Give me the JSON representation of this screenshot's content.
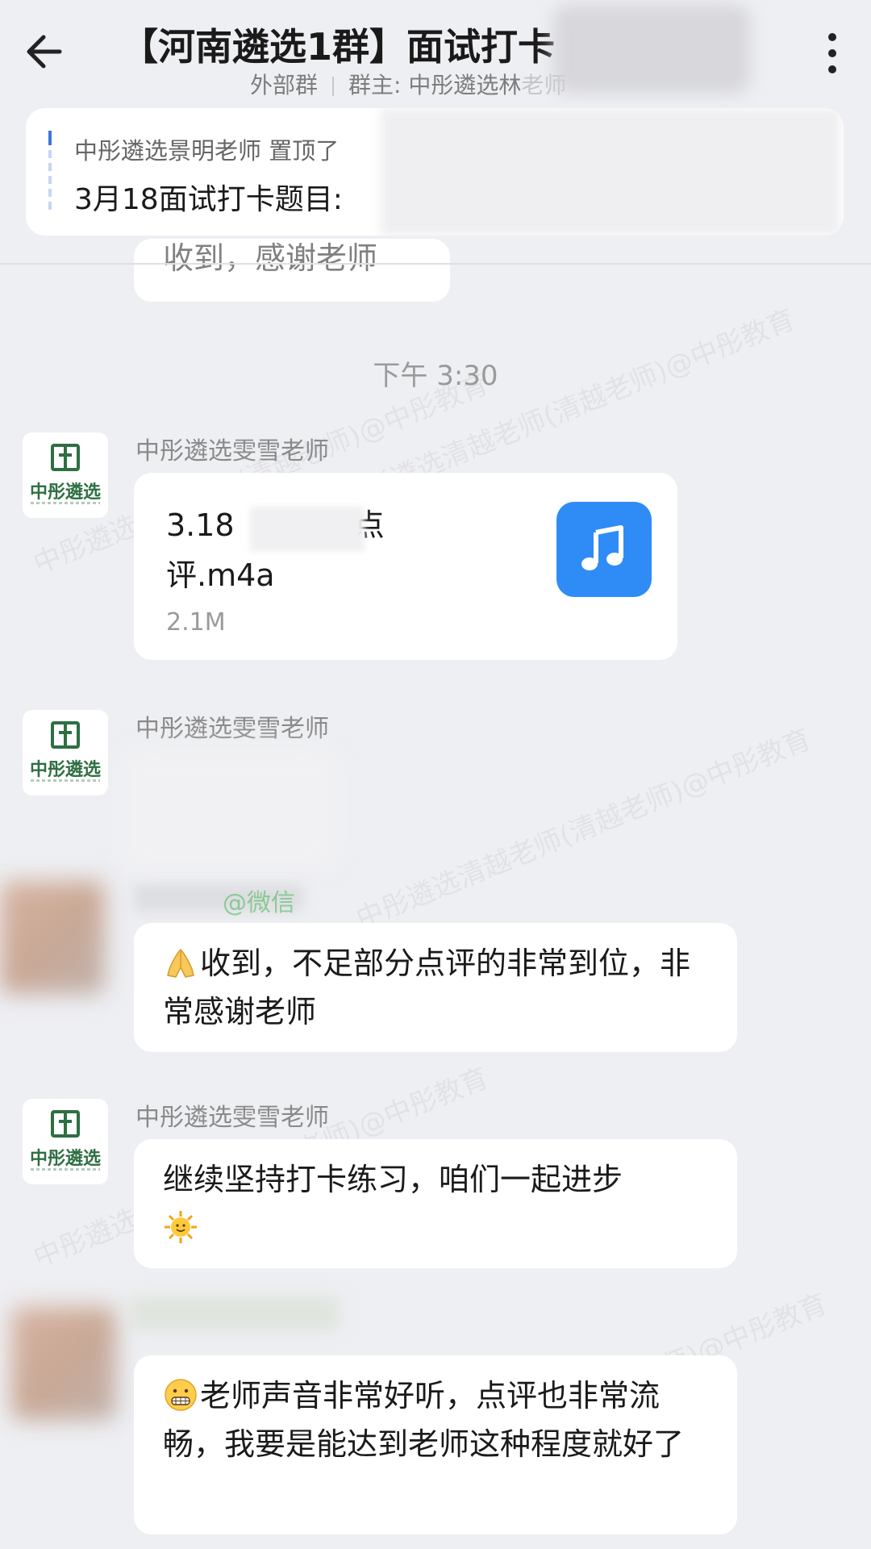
{
  "header": {
    "title": "【河南遴选1群】面试打卡",
    "external": "外部群",
    "owner": "群主: 中彤遴选林",
    "owner_suffix": "老师"
  },
  "pinned": {
    "line1": "中彤遴选景明老师 置顶了",
    "line2": "3月18面试打卡题目:"
  },
  "prev_message_tail": "收到，感谢老师",
  "timestamp": "下午 3:30",
  "messages": [
    {
      "sender": "中彤遴选雯雪老师",
      "avatar_text": "中彤遴选",
      "file": {
        "name_part1": "3.18",
        "name_part2": "点",
        "name_part3": "评.m4a",
        "size": "2.1M",
        "icon": "music-note-icon"
      }
    },
    {
      "sender": "中彤遴选雯雪老师",
      "avatar_text": "中彤遴选"
    },
    {
      "sender_suffix": "@微信",
      "text": "收到，不足部分点评的非常到位，非常感谢老师",
      "emoji": "folded-hands-icon"
    },
    {
      "sender": "中彤遴选雯雪老师",
      "avatar_text": "中彤遴选",
      "text": "继续坚持打卡练习，咱们一起进步",
      "emoji": "sun-face-icon"
    },
    {
      "text": "老师声音非常好听，点评也非常流畅，我要是能达到老师这种程度就好了",
      "emoji": "grimace-face-icon"
    }
  ],
  "watermark": "中彤遴选清越老师(清越老师)@中彤教育",
  "colors": {
    "background": "#EEEFF3",
    "bubble": "#FFFFFF",
    "accent_blue": "#2F8CF6",
    "logo_green": "#2E6F42"
  }
}
